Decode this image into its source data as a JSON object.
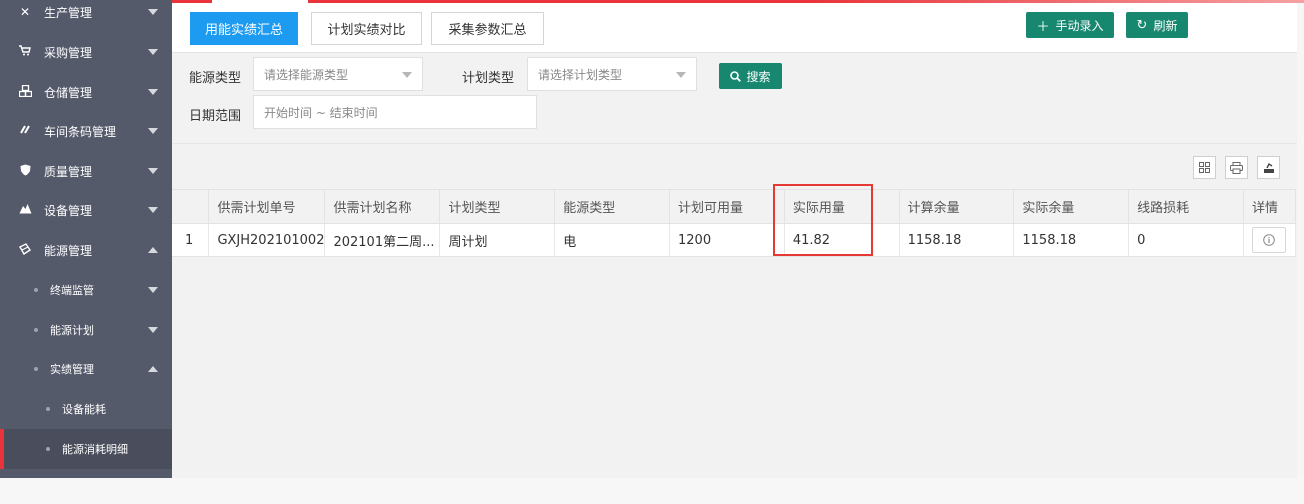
{
  "sidebar": {
    "menus": [
      {
        "label": "生产管理",
        "icon": "tools-icon",
        "glyph": "✕",
        "expanded": false
      },
      {
        "label": "采购管理",
        "icon": "cart-icon",
        "glyph": "🛒",
        "expanded": false
      },
      {
        "label": "仓储管理",
        "icon": "boxes-icon",
        "glyph": "❖",
        "expanded": false
      },
      {
        "label": "车间条码管理",
        "icon": "barcode-icon",
        "glyph": "✐",
        "expanded": false
      },
      {
        "label": "质量管理",
        "icon": "shield-icon",
        "glyph": "⛨",
        "expanded": false
      },
      {
        "label": "设备管理",
        "icon": "equipment-icon",
        "glyph": "⛰",
        "expanded": false
      },
      {
        "label": "能源管理",
        "icon": "energy-icon",
        "glyph": "◈",
        "expanded": true
      }
    ],
    "subs": [
      {
        "label": "终端监管",
        "expanded": false
      },
      {
        "label": "能源计划",
        "expanded": false
      },
      {
        "label": "实绩管理",
        "expanded": true
      }
    ],
    "leaves": [
      {
        "label": "设备能耗"
      },
      {
        "label": "能源消耗明细"
      }
    ]
  },
  "tabs": [
    "用能实绩汇总",
    "计划实绩对比",
    "采集参数汇总"
  ],
  "toolbar": {
    "manual_entry": "手动录入",
    "refresh": "刷新"
  },
  "filters": {
    "energy_type_label": "能源类型",
    "energy_type_placeholder": "请选择能源类型",
    "plan_type_label": "计划类型",
    "plan_type_placeholder": "请选择计划类型",
    "search_label": "搜索",
    "date_label": "日期范围",
    "date_placeholder": "开始时间 ~ 结束时间"
  },
  "table": {
    "headers": [
      "",
      "供需计划单号",
      "供需计划名称",
      "计划类型",
      "能源类型",
      "计划可用量",
      "实际用量",
      "计算余量",
      "实际余量",
      "线路损耗",
      "详情"
    ],
    "rows": [
      [
        "1",
        "GXJH202101002",
        "202101第二周...",
        "周计划",
        "电",
        "1200",
        "41.82",
        "1158.18",
        "1158.18",
        "0"
      ]
    ]
  },
  "colors": {
    "accent": "#1c9bf0",
    "green": "#17876f",
    "sidebar": "#555a6b",
    "highlight": "#e53935"
  }
}
